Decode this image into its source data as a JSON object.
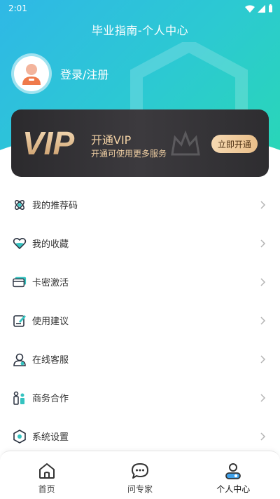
{
  "status_bar": {
    "time": "2:01"
  },
  "header": {
    "title": "毕业指南-个人中心"
  },
  "profile": {
    "login_label": "登录/注册"
  },
  "vip": {
    "logo_text": "VIP",
    "title": "开通VIP",
    "subtitle": "开通可使用更多服务",
    "button_label": "立即开通",
    "colors": {
      "card": "#2e2d30",
      "gold": "#f3d2a5",
      "button": "#eabf8a"
    }
  },
  "menu": {
    "items": [
      {
        "label": "我的推荐码",
        "icon": "recommend-code-icon"
      },
      {
        "label": "我的收藏",
        "icon": "heart-icon"
      },
      {
        "label": "卡密激活",
        "icon": "card-icon"
      },
      {
        "label": "使用建议",
        "icon": "feedback-icon"
      },
      {
        "label": "在线客服",
        "icon": "customer-service-icon"
      },
      {
        "label": "商务合作",
        "icon": "business-icon"
      },
      {
        "label": "系统设置",
        "icon": "settings-icon"
      }
    ]
  },
  "tabbar": {
    "tabs": [
      {
        "label": "首页",
        "icon": "home-icon"
      },
      {
        "label": "问专家",
        "icon": "chat-icon"
      },
      {
        "label": "个人中心",
        "icon": "user-icon",
        "active": true
      }
    ]
  },
  "colors": {
    "header_start": "#2fb8e6",
    "header_end": "#29d6b8",
    "accent": "#2bc4c8"
  }
}
